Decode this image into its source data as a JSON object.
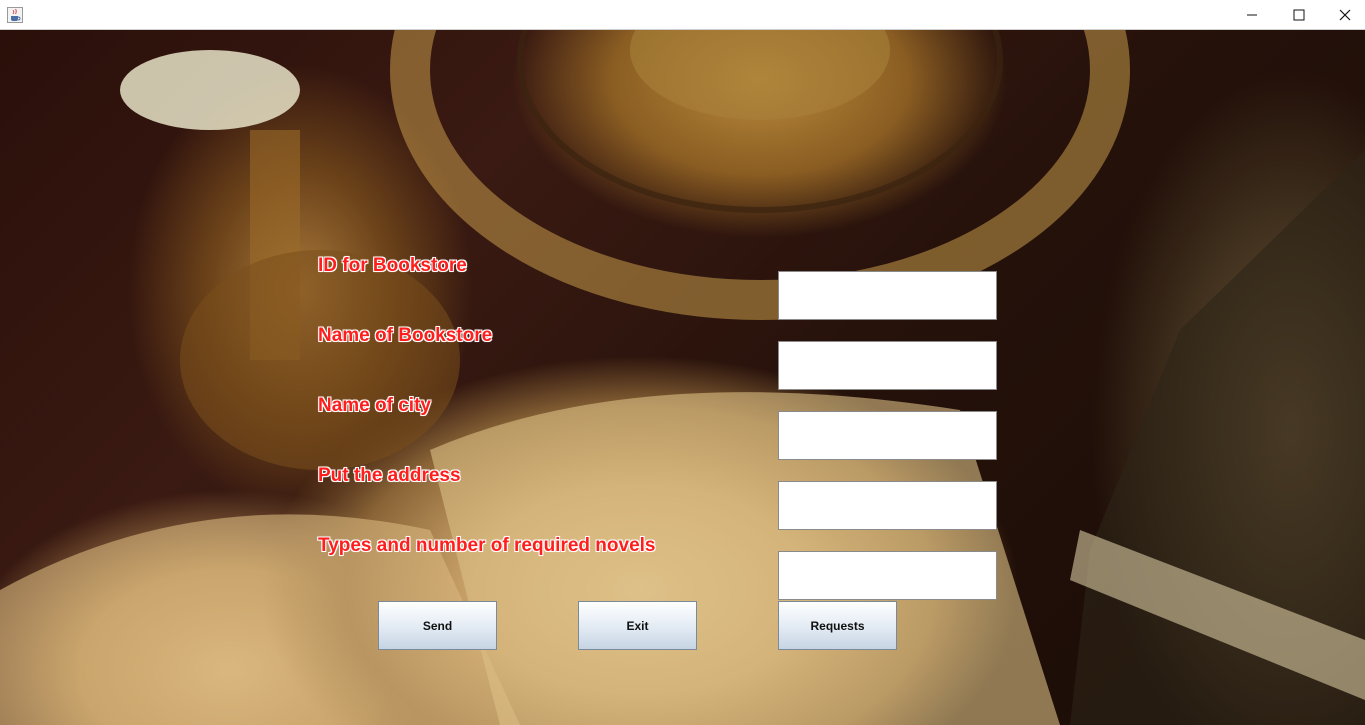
{
  "window": {
    "icon": "java-cup-icon",
    "controls": [
      "minimize-icon",
      "maximize-icon",
      "close-icon"
    ]
  },
  "form": {
    "fields": [
      {
        "label": "ID for Bookstore",
        "value": ""
      },
      {
        "label": "Name of Bookstore",
        "value": ""
      },
      {
        "label": "Name of city",
        "value": ""
      },
      {
        "label": "Put the address",
        "value": ""
      },
      {
        "label": "Types and number of required novels",
        "value": ""
      }
    ],
    "label_color": "#ff1e1e"
  },
  "buttons": {
    "send": "Send",
    "exit": "Exit",
    "requests": "Requests"
  }
}
